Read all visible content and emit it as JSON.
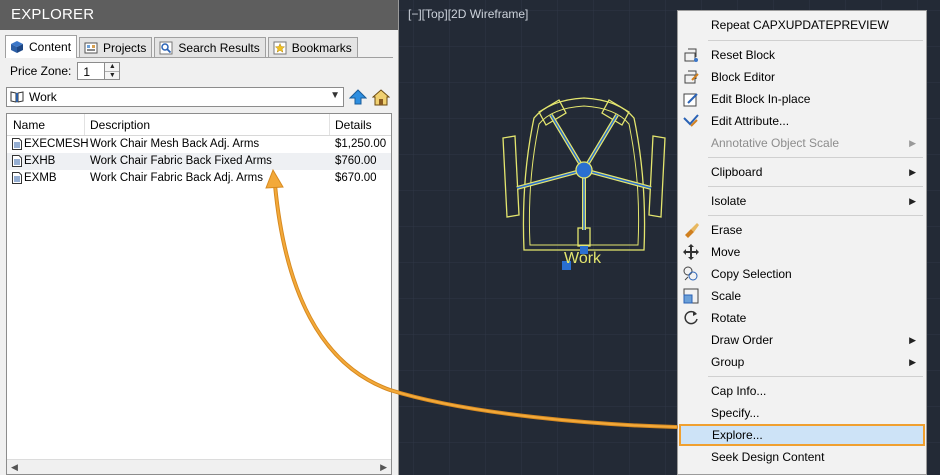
{
  "explorer": {
    "title": "EXPLORER",
    "tabs": [
      {
        "label": "Content",
        "icon": "cube-icon"
      },
      {
        "label": "Projects",
        "icon": "projects-icon"
      },
      {
        "label": "Search Results",
        "icon": "search-icon"
      },
      {
        "label": "Bookmarks",
        "icon": "star-icon"
      }
    ],
    "price_zone_label": "Price Zone:",
    "price_zone_value": "1",
    "folder_combo_value": "Work",
    "columns": [
      "Name",
      "Description",
      "Details"
    ],
    "rows": [
      {
        "name": "EXECMESH",
        "description": "Work Chair Mesh Back Adj. Arms",
        "details": "$1,250.00"
      },
      {
        "name": "EXHB",
        "description": "Work Chair Fabric Back Fixed Arms",
        "details": "$760.00"
      },
      {
        "name": "EXMB",
        "description": "Work Chair Fabric Back Adj. Arms",
        "details": "$670.00"
      }
    ]
  },
  "canvas": {
    "view_label": "[−][Top][2D Wireframe]",
    "block_label": "Work",
    "colors": {
      "background": "#232a36",
      "chair_stroke": "#e4e66e",
      "chair_fill": "#2a6fd0"
    }
  },
  "context_menu": {
    "items": [
      {
        "label": "Repeat CAPXUPDATEPREVIEW"
      },
      {
        "label": "Reset Block",
        "icon": "reset-block-icon"
      },
      {
        "label": "Block Editor",
        "icon": "block-editor-icon"
      },
      {
        "label": "Edit Block In-place",
        "icon": "edit-block-icon"
      },
      {
        "label": "Edit Attribute...",
        "icon": "edit-attribute-icon"
      },
      {
        "label": "Annotative Object Scale",
        "disabled": true,
        "submenu": true
      },
      {
        "label": "Clipboard",
        "submenu": true
      },
      {
        "label": "Isolate",
        "submenu": true
      },
      {
        "label": "Erase",
        "icon": "eraser-icon"
      },
      {
        "label": "Move",
        "icon": "move-icon"
      },
      {
        "label": "Copy Selection",
        "icon": "copy-icon"
      },
      {
        "label": "Scale",
        "icon": "scale-icon"
      },
      {
        "label": "Rotate",
        "icon": "rotate-icon"
      },
      {
        "label": "Draw Order",
        "submenu": true
      },
      {
        "label": "Group",
        "submenu": true
      },
      {
        "label": "Cap Info..."
      },
      {
        "label": "Specify..."
      },
      {
        "label": "Explore...",
        "highlighted": true
      },
      {
        "label": "Seek Design Content"
      }
    ]
  },
  "annotation": {
    "arrow_color": "#f0a030"
  }
}
